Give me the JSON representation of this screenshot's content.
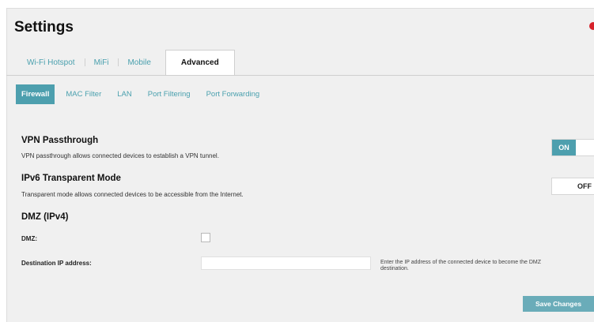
{
  "page": {
    "title": "Settings"
  },
  "tabs": [
    {
      "label": "Wi-Fi Hotspot",
      "active": false
    },
    {
      "label": "MiFi",
      "active": false
    },
    {
      "label": "Mobile",
      "active": false
    },
    {
      "label": "Advanced",
      "active": true
    }
  ],
  "subtabs": [
    {
      "label": "Firewall",
      "active": true
    },
    {
      "label": "MAC Filter",
      "active": false
    },
    {
      "label": "LAN",
      "active": false
    },
    {
      "label": "Port Filtering",
      "active": false
    },
    {
      "label": "Port Forwarding",
      "active": false
    }
  ],
  "vpn": {
    "heading": "VPN Passthrough",
    "description": "VPN passthrough allows connected devices to establish a VPN tunnel.",
    "toggle_label": "ON",
    "enabled": true
  },
  "ipv6": {
    "heading": "IPv6 Transparent Mode",
    "description": "Transparent mode allows connected devices to be accessible from the Internet.",
    "toggle_label": "OFF",
    "enabled": false
  },
  "dmz": {
    "heading": "DMZ (IPv4)",
    "dmz_label": "DMZ:",
    "dmz_checked": false,
    "dest_label": "Destination IP address:",
    "dest_value": "",
    "hint": "Enter the IP address of the connected device to become the DMZ destination."
  },
  "actions": {
    "save_label": "Save Changes"
  },
  "colors": {
    "accent": "#4d9fae",
    "alert_dot": "#d6222b",
    "panel_bg": "#f0f0f0"
  },
  "icons": {
    "alert": "red-dot-icon"
  }
}
